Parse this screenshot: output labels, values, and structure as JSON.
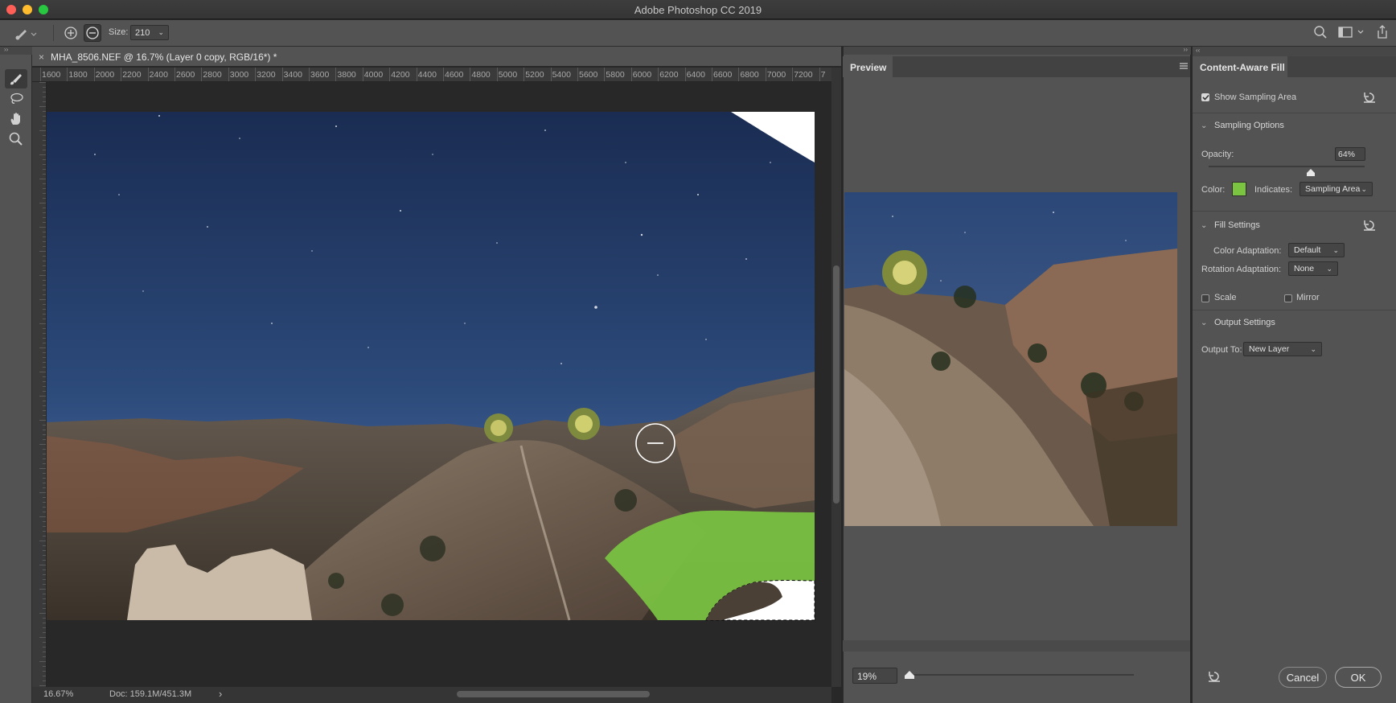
{
  "app": {
    "title": "Adobe Photoshop CC 2019",
    "colors": {
      "chrome": "#535353",
      "canvas_bg": "#282828",
      "sampling": "#7bc442"
    }
  },
  "options_bar": {
    "size_label": "Size:",
    "size_value": "210",
    "icons": [
      "brush-preset-icon",
      "add-mode-icon",
      "subtract-mode-icon",
      "search-icon",
      "workspace-icon",
      "share-icon"
    ]
  },
  "tools": [
    "brush-icon",
    "lasso-icon",
    "hand-icon",
    "zoom-icon"
  ],
  "document": {
    "tab_title": "MHA_8506.NEF @ 16.7% (Layer 0 copy, RGB/16*) *",
    "ruler_h": [
      "1600",
      "1800",
      "2000",
      "2200",
      "2400",
      "2600",
      "2800",
      "3000",
      "3200",
      "3400",
      "3600",
      "3800",
      "4000",
      "4200",
      "4400",
      "4600",
      "4800",
      "5000",
      "5200",
      "5400",
      "5600",
      "5800",
      "6000",
      "6200",
      "6400",
      "6600",
      "6800",
      "7000",
      "7200",
      "7"
    ],
    "status_zoom": "16.67%",
    "status_doc": "Doc: 159.1M/451.3M"
  },
  "preview": {
    "tab": "Preview",
    "zoom_value": "19%"
  },
  "caf": {
    "tab": "Content-Aware Fill",
    "show_sampling": "Show Sampling Area",
    "sampling_options": "Sampling Options",
    "opacity_label": "Opacity:",
    "opacity_value": "64%",
    "opacity_fraction": 0.64,
    "color_label": "Color:",
    "indicates_label": "Indicates:",
    "indicates_value": "Sampling Area",
    "fill_settings": "Fill Settings",
    "color_adaptation_label": "Color Adaptation:",
    "color_adaptation_value": "Default",
    "rotation_adaptation_label": "Rotation Adaptation:",
    "rotation_adaptation_value": "None",
    "scale_label": "Scale",
    "mirror_label": "Mirror",
    "output_settings": "Output Settings",
    "output_to_label": "Output To:",
    "output_to_value": "New Layer",
    "cancel": "Cancel",
    "ok": "OK"
  }
}
